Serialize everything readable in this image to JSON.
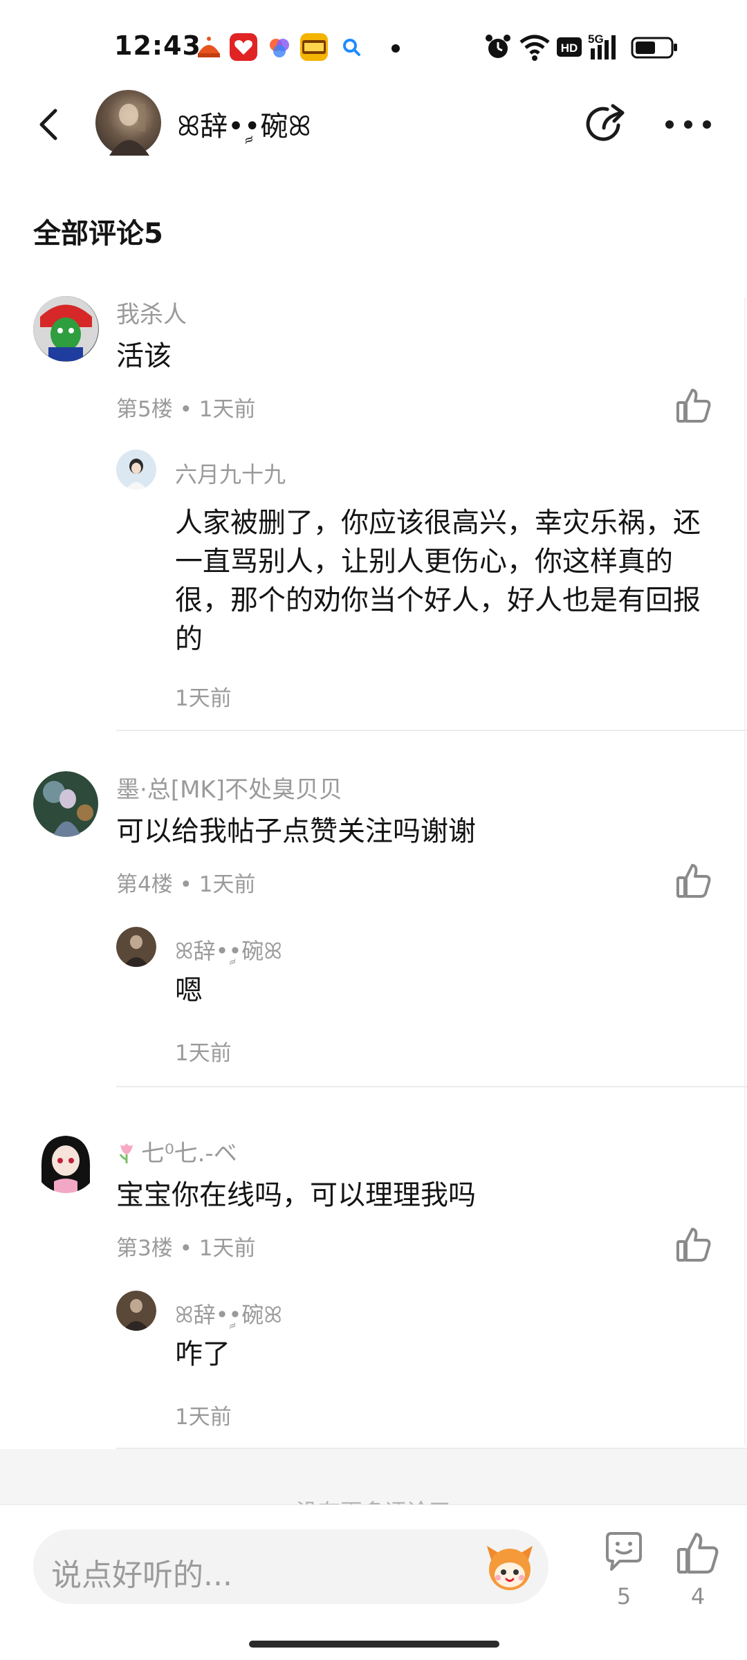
{
  "status_bar": {
    "time": "12:43",
    "network": "5G",
    "hd": "HD",
    "icons": [
      "alarm-icon",
      "wifi-icon",
      "hd-icon",
      "signal-5g-icon",
      "battery-icon"
    ]
  },
  "header": {
    "name": "ꕤ辞•ࣩ•碗ꕤ"
  },
  "comments_section": {
    "title": "全部评论5"
  },
  "comments": [
    {
      "name": "我杀人",
      "text": "活该",
      "meta": "第5楼 • 1天前",
      "reply": {
        "name": "六月九十九",
        "text": "人家被删了，你应该很高兴，幸灾乐祸，还一直骂别人，让别人更伤心，你这样真的很，那个的劝你当个好人，好人也是有回报的",
        "time": "1天前"
      }
    },
    {
      "name": "墨·总[MK]不处臭贝贝",
      "text": "可以给我帖子点赞关注吗谢谢",
      "meta": "第4楼 • 1天前",
      "reply": {
        "name": "ꕤ辞•ࣩ•碗ꕤ",
        "text": "嗯",
        "time": "1天前"
      }
    },
    {
      "name": "七⁰七.-ベ",
      "text": "宝宝你在线吗，可以理理我吗",
      "meta": "第3楼 • 1天前",
      "reply": {
        "name": "ꕤ辞•ࣩ•碗ꕤ",
        "text": "咋了",
        "time": "1天前"
      }
    }
  ],
  "footer": {
    "no_more": "没有更多评论了",
    "input_placeholder": "说点好听的...",
    "comment_count": "5",
    "like_count": "4"
  }
}
